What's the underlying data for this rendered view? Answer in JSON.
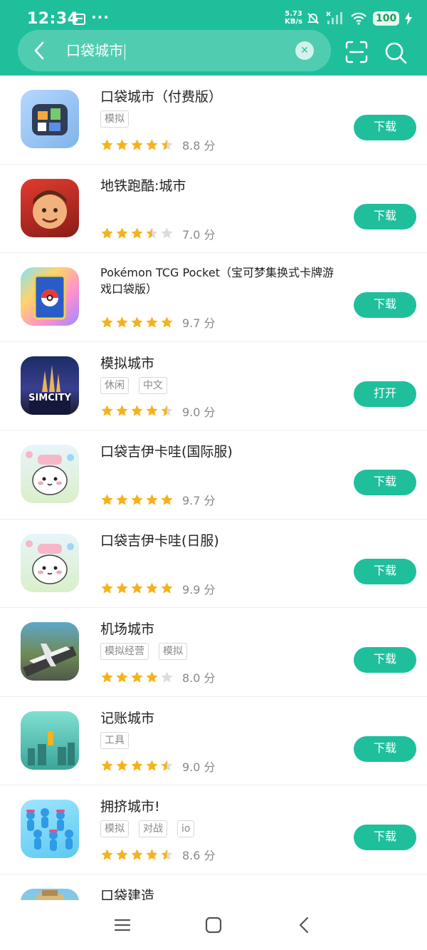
{
  "status_bar": {
    "time": "12:34",
    "dots": "···",
    "net_speed_value": "5.73",
    "net_speed_unit": "KB/s",
    "battery": "100"
  },
  "search": {
    "query": "口袋城市"
  },
  "colors": {
    "accent": "#1fbf9c",
    "star": "#f6b21b",
    "star_empty": "#dddddd"
  },
  "apps": [
    {
      "name": "口袋城市（付费版）",
      "tags": [
        "模拟"
      ],
      "stars": 4.5,
      "score": "8.8 分",
      "action": "下载",
      "icon": "pocket-city-icon"
    },
    {
      "name": "地铁跑酷:城市",
      "tags": [],
      "stars": 3.5,
      "score": "7.0 分",
      "action": "下载",
      "icon": "subway-surfers-icon"
    },
    {
      "name": "Pokémon TCG Pocket（宝可梦集换式卡牌游戏口袋版）",
      "tags": [],
      "stars": 5,
      "score": "9.7 分",
      "action": "下载",
      "icon": "pokemon-tcg-icon"
    },
    {
      "name": "模拟城市",
      "tags": [
        "休闲",
        "中文"
      ],
      "stars": 4.5,
      "score": "9.0 分",
      "action": "打开",
      "icon": "simcity-icon"
    },
    {
      "name": "口袋吉伊卡哇(国际服)",
      "tags": [],
      "stars": 5,
      "score": "9.7 分",
      "action": "下载",
      "icon": "chiikawa-icon"
    },
    {
      "name": "口袋吉伊卡哇(日服)",
      "tags": [],
      "stars": 5,
      "score": "9.9 分",
      "action": "下载",
      "icon": "chiikawa-icon"
    },
    {
      "name": "机场城市",
      "tags": [
        "模拟经营",
        "模拟"
      ],
      "stars": 4,
      "score": "8.0 分",
      "action": "下载",
      "icon": "airport-city-icon"
    },
    {
      "name": "记账城市",
      "tags": [
        "工具"
      ],
      "stars": 4.5,
      "score": "9.0 分",
      "action": "下载",
      "icon": "fortune-city-icon"
    },
    {
      "name": "拥挤城市!",
      "tags": [
        "模拟",
        "对战",
        "io"
      ],
      "stars": 4.5,
      "score": "8.6 分",
      "action": "下载",
      "icon": "crowd-city-icon"
    },
    {
      "name": "口袋建造",
      "tags": [],
      "stars": 0,
      "score": "",
      "action": "",
      "icon": "pocket-build-icon"
    }
  ]
}
